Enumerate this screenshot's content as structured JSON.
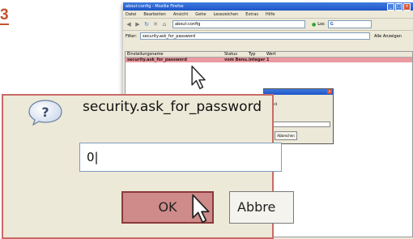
{
  "step_number": "3",
  "browser": {
    "title": "about:config - Mozilla Firefox",
    "menu": [
      "Datei",
      "Bearbeiten",
      "Ansicht",
      "Gehe",
      "Lesezeichen",
      "Extras",
      "Hilfe"
    ],
    "url": "about:config",
    "go_label": "Los",
    "search_engine": "G",
    "filter_label": "Filter:",
    "filter_value": "security.ask_for_password",
    "filter_button": "Alle Anzeigen",
    "columns": [
      "Einstellungsname",
      "Status",
      "Typ",
      "Wert"
    ],
    "rows": [
      {
        "name": "security.ask_for_password",
        "status": "vom Benu...",
        "type": "integer",
        "value": "1"
      }
    ]
  },
  "bg_dialog": {
    "fragment": "rd",
    "button": "Abbrechen"
  },
  "dialog": {
    "prompt": "security.ask_for_password",
    "input_value": "0",
    "ok_label": "OK",
    "cancel_label": "Abbre"
  },
  "colors": {
    "accent": "#c0542f",
    "highlight": "#ea9aa0",
    "ok_button": "#cf8a8a"
  },
  "icons": [
    "question-icon",
    "back-icon",
    "forward-icon",
    "reload-icon",
    "stop-icon",
    "home-icon",
    "go-icon",
    "mouse-cursor-icon"
  ]
}
